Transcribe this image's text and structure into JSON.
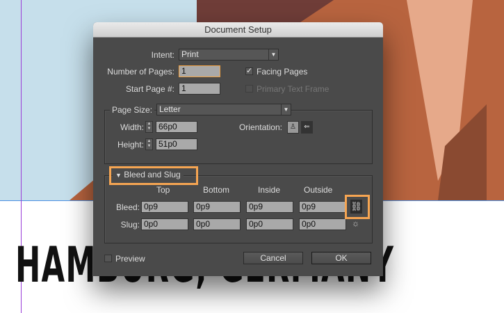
{
  "background": {
    "headline": "HAMBURG, GERMANY"
  },
  "dialog": {
    "title": "Document Setup",
    "intent_label": "Intent:",
    "intent_value": "Print",
    "pages_label": "Number of Pages:",
    "pages_value": "1",
    "start_label": "Start Page #:",
    "start_value": "1",
    "facing_label": "Facing Pages",
    "facing_checked": true,
    "primary_label": "Primary Text Frame",
    "primary_checked": false,
    "page_size_label": "Page Size:",
    "page_size_value": "Letter",
    "width_label": "Width:",
    "width_value": "66p0",
    "height_label": "Height:",
    "height_value": "51p0",
    "orientation_label": "Orientation:",
    "bleed_section_label": "Bleed and Slug",
    "columns": [
      "Top",
      "Bottom",
      "Inside",
      "Outside"
    ],
    "bleed_label": "Bleed:",
    "bleed_values": [
      "0p9",
      "0p9",
      "0p9",
      "0p9"
    ],
    "slug_label": "Slug:",
    "slug_values": [
      "0p0",
      "0p0",
      "0p0",
      "0p0"
    ],
    "preview_label": "Preview",
    "cancel_label": "Cancel",
    "ok_label": "OK"
  },
  "colors": {
    "highlight": "#f6a552",
    "dialog_bg": "#4a4a4a"
  }
}
